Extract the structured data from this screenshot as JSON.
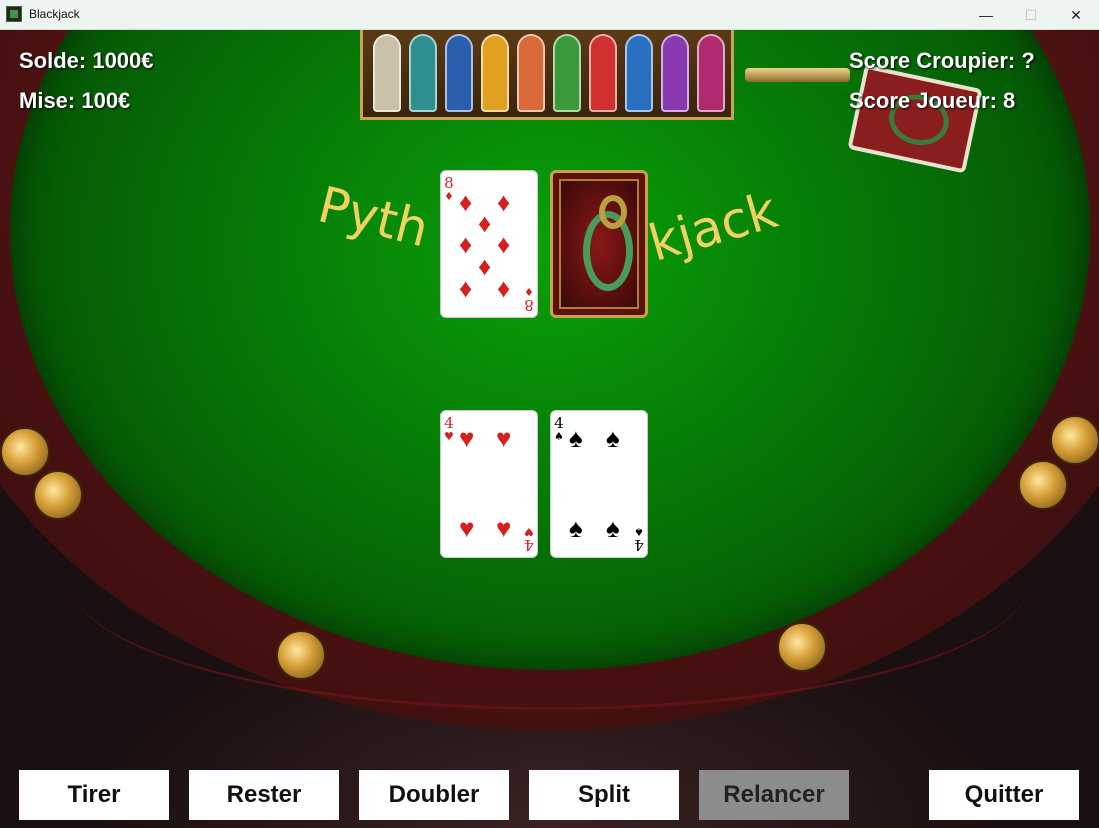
{
  "window": {
    "title": "Blackjack"
  },
  "stats": {
    "balance": "Solde: 1000€",
    "bet": "Mise: 100€",
    "dealer_score": "Score Croupier: ?",
    "player_score": "Score Joueur: 8"
  },
  "logo": {
    "left_part": "Pyth",
    "right_part": "kjack"
  },
  "dealer_cards": [
    {
      "rank": "8",
      "suit": "♦",
      "color": "red",
      "face": "up"
    },
    {
      "face": "down"
    }
  ],
  "player_cards": [
    {
      "rank": "4",
      "suit": "♥",
      "color": "red",
      "face": "up"
    },
    {
      "rank": "4",
      "suit": "♠",
      "color": "black",
      "face": "up"
    }
  ],
  "buttons": {
    "hit": "Tirer",
    "stand": "Rester",
    "double": "Doubler",
    "split": "Split",
    "rebet": "Relancer",
    "quit": "Quitter"
  },
  "colors": {
    "felt": "#067d06",
    "logo": "#f0d262",
    "button_disabled": "#8c8c8c"
  }
}
